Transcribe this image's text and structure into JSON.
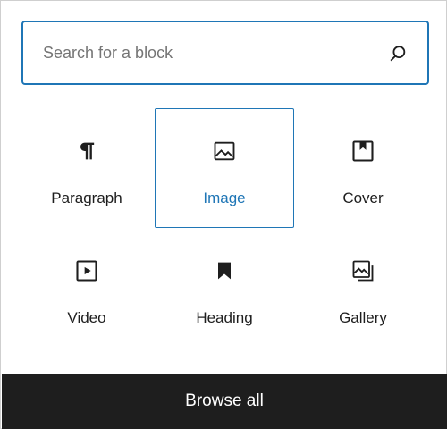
{
  "search": {
    "placeholder": "Search for a block",
    "icon": "search-icon"
  },
  "blocks": [
    {
      "label": "Paragraph",
      "icon": "paragraph-icon",
      "selected": false
    },
    {
      "label": "Image",
      "icon": "image-icon",
      "selected": true
    },
    {
      "label": "Cover",
      "icon": "cover-icon",
      "selected": false
    },
    {
      "label": "Video",
      "icon": "video-icon",
      "selected": false
    },
    {
      "label": "Heading",
      "icon": "heading-icon",
      "selected": false
    },
    {
      "label": "Gallery",
      "icon": "gallery-icon",
      "selected": false
    }
  ],
  "footer": {
    "browse_label": "Browse all"
  },
  "colors": {
    "accent": "#1f76b6",
    "text": "#1e1e1e",
    "footer_bg": "#1e1e1e"
  }
}
